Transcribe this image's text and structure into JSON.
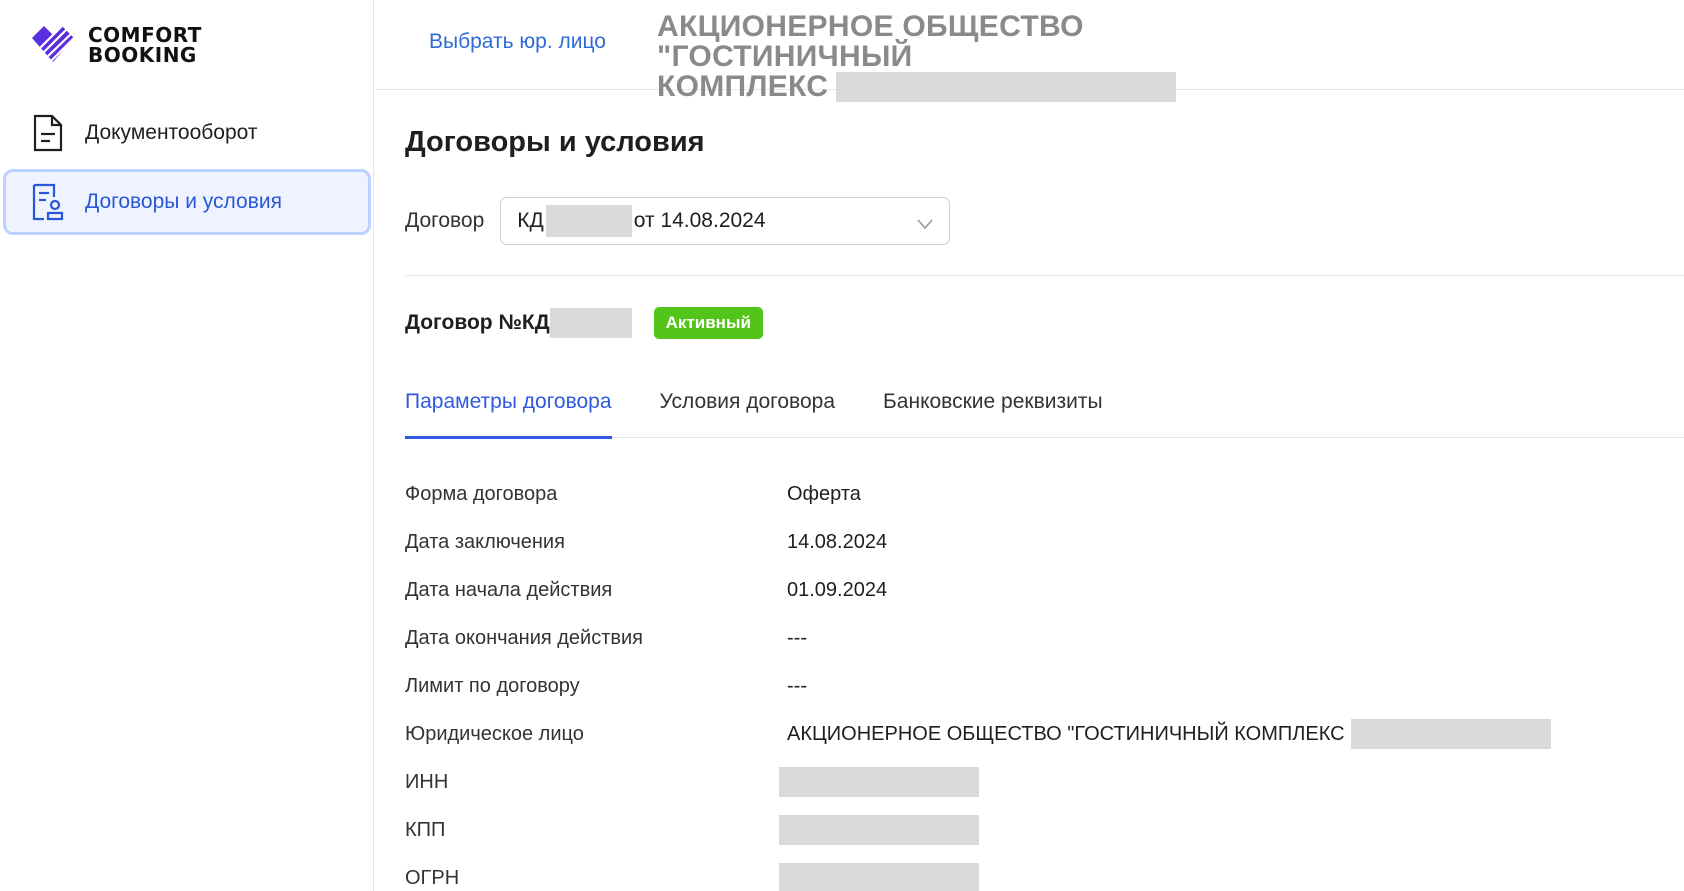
{
  "brand": {
    "line1": "COMFORT",
    "line2": "BOOKING",
    "accent": "#5b2ee0"
  },
  "sidebar": {
    "items": [
      {
        "label": "Документооборот",
        "icon": "document-icon",
        "active": false
      },
      {
        "label": "Договоры и условия",
        "icon": "contract-icon",
        "active": true
      }
    ]
  },
  "header": {
    "select_entity": "Выбрать юр. лицо",
    "org_title_line1": "АКЦИОНЕРНОЕ ОБЩЕСТВО \"ГОСТИНИЧНЫЙ",
    "org_title_line2": "КОМПЛЕКС"
  },
  "main": {
    "title": "Договоры и условия",
    "contract_label": "Договор",
    "contract_select_prefix": "КД",
    "contract_select_suffix": "от 14.08.2024",
    "contract_number": "Договор №КД",
    "status": "Активный",
    "tabs": [
      {
        "label": "Параметры договора",
        "active": true
      },
      {
        "label": "Условия договора",
        "active": false
      },
      {
        "label": "Банковские реквизиты",
        "active": false
      }
    ],
    "params": [
      {
        "label": "Форма договора",
        "value": "Оферта"
      },
      {
        "label": "Дата заключения",
        "value": "14.08.2024"
      },
      {
        "label": "Дата начала действия",
        "value": "01.09.2024"
      },
      {
        "label": "Дата окончания действия",
        "value": "---"
      },
      {
        "label": "Лимит по договору",
        "value": "---"
      },
      {
        "label": "Юридическое лицо",
        "value": "АКЦИОНЕРНОЕ ОБЩЕСТВО \"ГОСТИНИЧНЫЙ КОМПЛЕКС"
      },
      {
        "label": "ИНН",
        "value": ""
      },
      {
        "label": "КПП",
        "value": ""
      },
      {
        "label": "ОГРН",
        "value": ""
      }
    ]
  },
  "colors": {
    "link": "#2e6bd8",
    "active_nav": "#2a56d8",
    "status_green": "#52c41a"
  }
}
